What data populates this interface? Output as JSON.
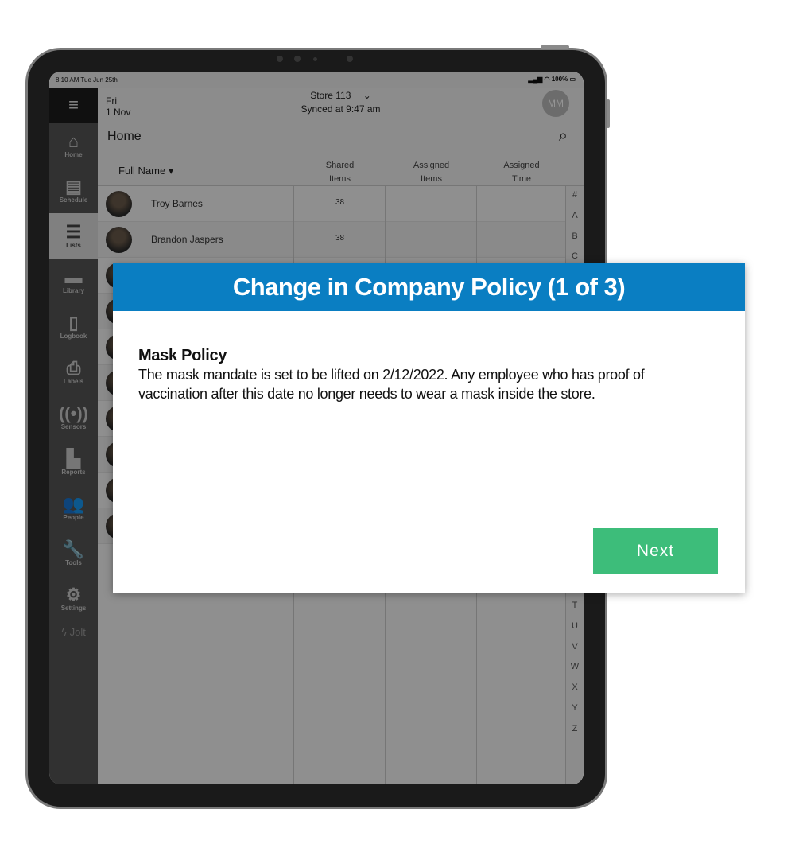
{
  "status_bar": {
    "time": "8:10 AM Tue Jun 25th",
    "battery": "100%"
  },
  "sidebar": {
    "items": [
      {
        "label": "Home",
        "icon": "home-icon",
        "glyph": "⌂"
      },
      {
        "label": "Schedule",
        "icon": "calendar-icon",
        "glyph": "▤"
      },
      {
        "label": "Lists",
        "icon": "checklist-icon",
        "glyph": "☰",
        "active": true
      },
      {
        "label": "Library",
        "icon": "folder-icon",
        "glyph": "▬"
      },
      {
        "label": "Logbook",
        "icon": "book-icon",
        "glyph": "▯"
      },
      {
        "label": "Labels",
        "icon": "printer-icon",
        "glyph": "⎙"
      },
      {
        "label": "Sensors",
        "icon": "sensor-icon",
        "glyph": "((•))"
      },
      {
        "label": "Reports",
        "icon": "bar-chart-icon",
        "glyph": "▙"
      },
      {
        "label": "People",
        "icon": "people-icon",
        "glyph": "👥"
      },
      {
        "label": "Tools",
        "icon": "wrench-icon",
        "glyph": "🔧"
      },
      {
        "label": "Settings",
        "icon": "gear-icon",
        "glyph": "⚙"
      }
    ],
    "brand": "Jolt"
  },
  "header": {
    "day": "Fri",
    "date": "1 Nov",
    "store": "Store 113",
    "synced": "Synced at 9:47 am",
    "avatar_initials": "MM",
    "page_title": "Home"
  },
  "table": {
    "columns": [
      {
        "l1": "Full Name ▾"
      },
      {
        "l1": "Shared",
        "l2": "Items"
      },
      {
        "l1": "Assigned",
        "l2": "Items"
      },
      {
        "l1": "Assigned",
        "l2": "Time"
      }
    ],
    "rows": [
      {
        "name": "Troy Barnes",
        "shared": "38"
      },
      {
        "name": "Brandon Jaspers",
        "shared": "38"
      },
      {},
      {},
      {},
      {},
      {},
      {},
      {},
      {}
    ],
    "index_top": [
      "#",
      "A",
      "B",
      "C"
    ],
    "index_bottom": [
      "T",
      "U",
      "V",
      "W",
      "X",
      "Y",
      "Z"
    ]
  },
  "modal": {
    "title": "Change in Company Policy (1 of 3)",
    "heading": "Mask Policy",
    "body": "The mask mandate is set to be lifted on 2/12/2022. Any employee who has proof of vaccination after this date no longer needs to wear a mask inside the store.",
    "next_label": "Next",
    "colors": {
      "header": "#0a7ec2",
      "button": "#3dbd7a"
    }
  }
}
